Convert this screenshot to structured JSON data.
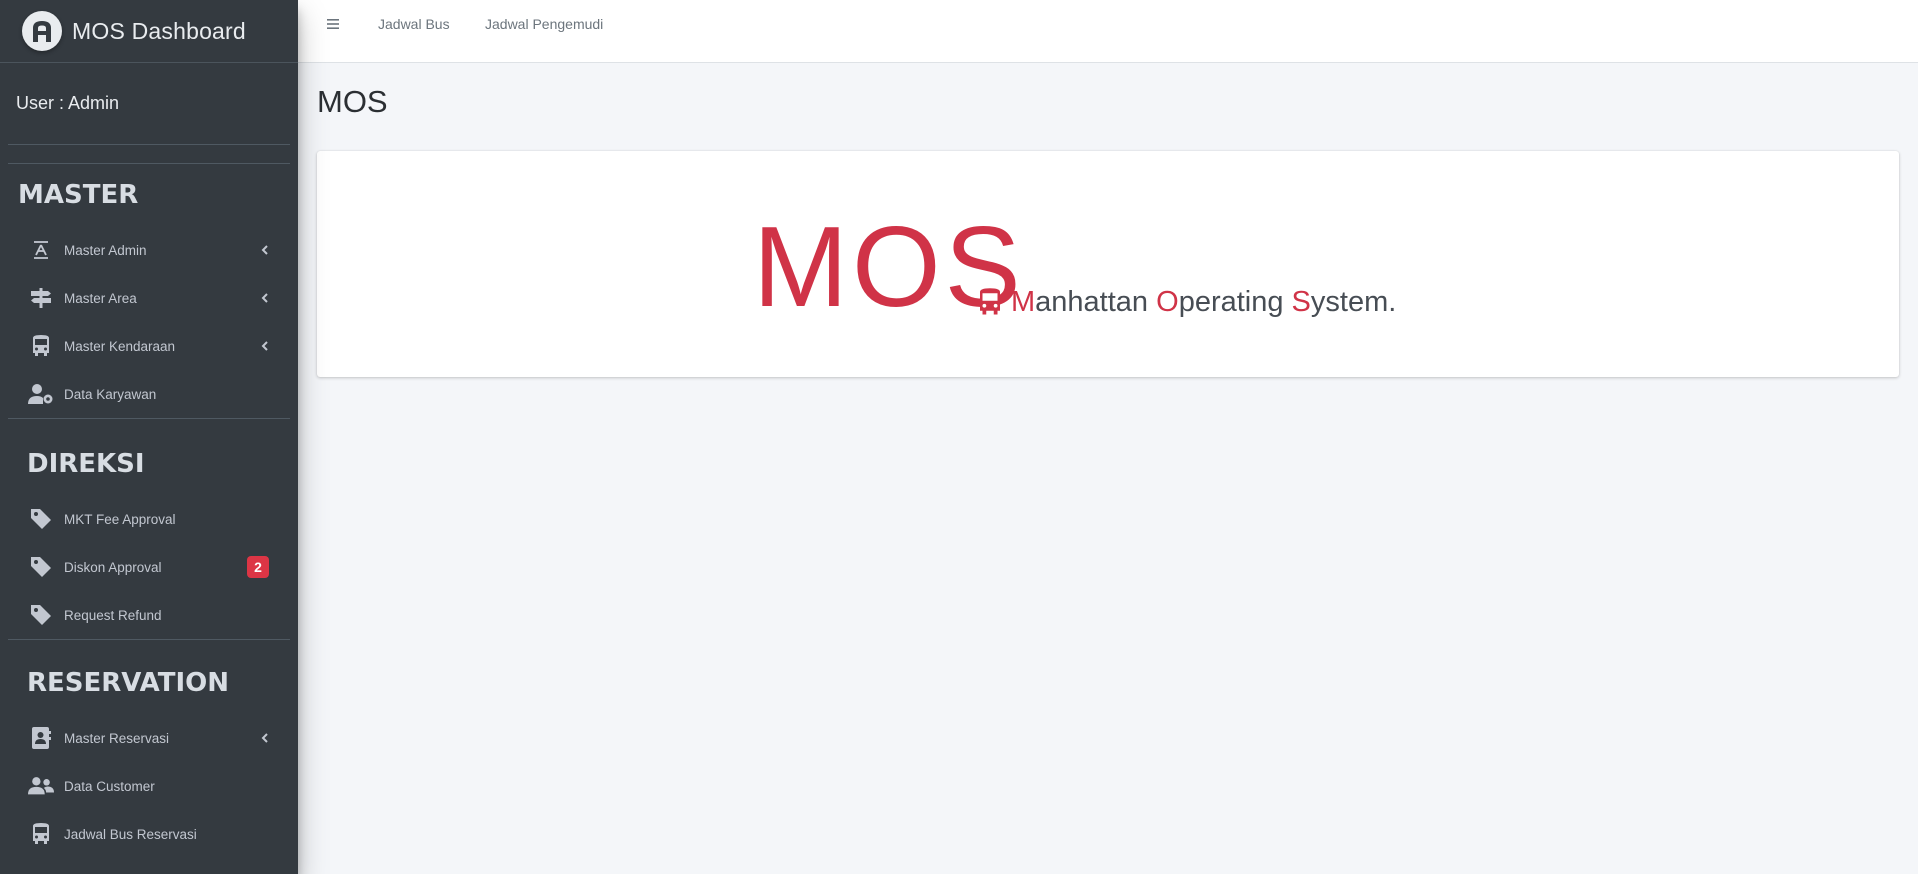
{
  "brand": {
    "title": "MOS Dashboard",
    "logo_icon": "letter-a-logo"
  },
  "user_panel": {
    "label": "User : Admin"
  },
  "sidebar": {
    "sections": [
      {
        "title": "MASTER",
        "items": [
          {
            "label": "Master Admin",
            "icon": "text-height-icon",
            "has_children": true
          },
          {
            "label": "Master Area",
            "icon": "signpost-icon",
            "has_children": true
          },
          {
            "label": "Master Kendaraan",
            "icon": "bus-icon",
            "has_children": true
          },
          {
            "label": "Data Karyawan",
            "icon": "user-cog-icon",
            "has_children": false
          }
        ]
      },
      {
        "title": "DIREKSI",
        "items": [
          {
            "label": "MKT Fee Approval",
            "icon": "tag-icon",
            "has_children": false
          },
          {
            "label": "Diskon Approval",
            "icon": "tag-icon",
            "has_children": false,
            "badge": "2"
          },
          {
            "label": "Request Refund",
            "icon": "tag-icon",
            "has_children": false
          }
        ]
      },
      {
        "title": "RESERVATION",
        "items": [
          {
            "label": "Master Reservasi",
            "icon": "address-book-icon",
            "has_children": true
          },
          {
            "label": "Data Customer",
            "icon": "users-icon",
            "has_children": false
          },
          {
            "label": "Jadwal Bus Reservasi",
            "icon": "bus-icon",
            "has_children": false
          }
        ]
      }
    ]
  },
  "navbar": {
    "menu_icon": "hamburger-icon",
    "links": [
      "Jadwal Bus",
      "Jadwal Pengemudi"
    ]
  },
  "content": {
    "page_title": "MOS",
    "logo": {
      "big_text": "MOS",
      "tagline_parts": [
        {
          "text": "M",
          "highlight": true
        },
        {
          "text": "anhattan ",
          "highlight": false
        },
        {
          "text": "O",
          "highlight": true
        },
        {
          "text": "perating ",
          "highlight": false
        },
        {
          "text": "S",
          "highlight": true
        },
        {
          "text": "ystem.",
          "highlight": false
        }
      ]
    }
  },
  "colors": {
    "sidebar_bg": "#343a40",
    "accent_red": "#d03347",
    "badge_red": "#dc3545",
    "content_bg": "#f4f6f9"
  }
}
